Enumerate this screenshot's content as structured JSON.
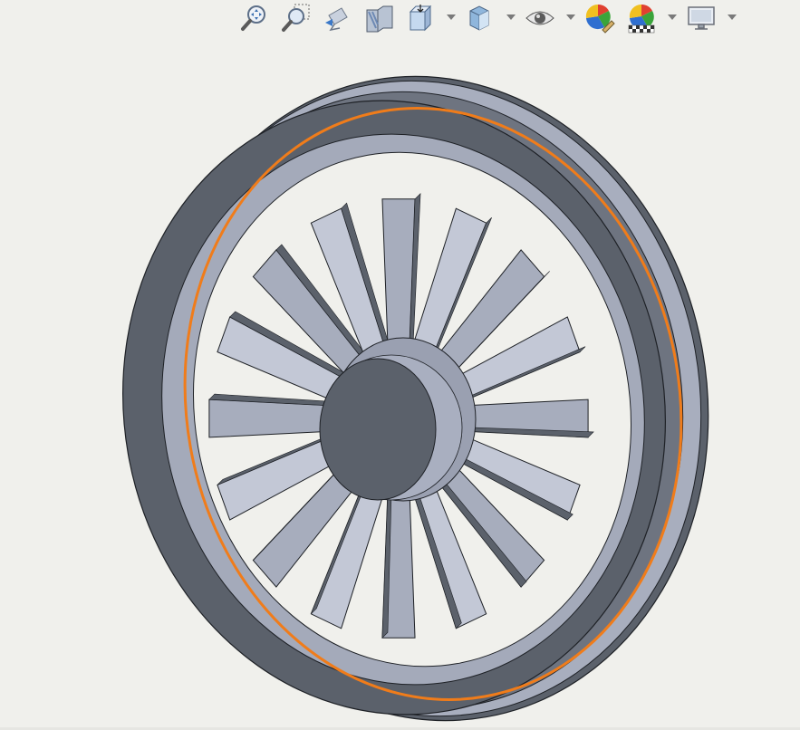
{
  "viewport": {
    "background_color": "#f0f0ec",
    "model_name": "",
    "selection_highlight_color": "#f07c1a"
  },
  "toolbar": {
    "buttons": [
      {
        "id": "zoom-to-fit",
        "icon": "zoom-to-fit-icon",
        "has_dropdown": false
      },
      {
        "id": "zoom-to-area",
        "icon": "zoom-to-area-icon",
        "has_dropdown": false
      },
      {
        "id": "previous-view",
        "icon": "previous-view-icon",
        "has_dropdown": false
      },
      {
        "id": "section-view",
        "icon": "section-view-icon",
        "has_dropdown": false
      },
      {
        "id": "view-orientation",
        "icon": "view-orientation-icon",
        "has_dropdown": true
      },
      {
        "id": "display-style",
        "icon": "display-style-icon",
        "has_dropdown": true
      },
      {
        "id": "hide-show-items",
        "icon": "eye-icon",
        "has_dropdown": true
      },
      {
        "id": "edit-appearance",
        "icon": "edit-appearance-icon",
        "has_dropdown": false
      },
      {
        "id": "apply-scene",
        "icon": "apply-scene-icon",
        "has_dropdown": true
      },
      {
        "id": "view-settings",
        "icon": "monitor-icon",
        "has_dropdown": true
      }
    ]
  },
  "wheel": {
    "spoke_count": 16,
    "body_color": "#5b616b",
    "face_color": "#a7adbd",
    "light_face_color": "#c3c8d6"
  }
}
